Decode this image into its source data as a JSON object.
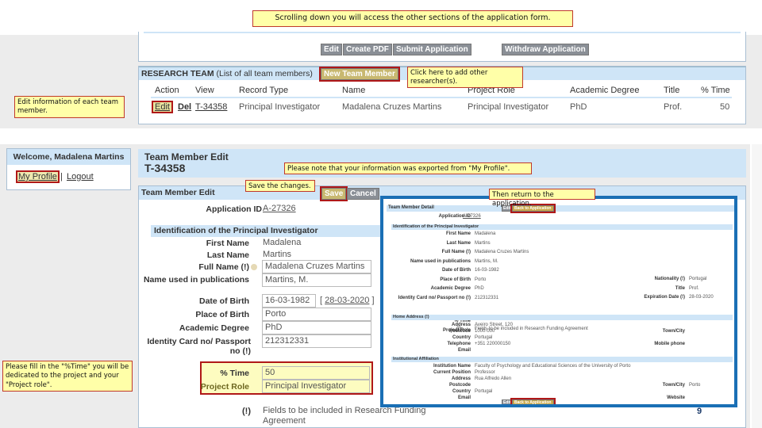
{
  "notes": {
    "top": "Scrolling down you will access the other sections of the application form.",
    "add": "Click here to add other researcher(s).",
    "edit": "Edit information of each team member.",
    "exported": "Please note that your information was exported from \"My Profile\".",
    "save": "Save the changes.",
    "return": "Then return to the application.",
    "fill": "Please fill in the \"%Time\" you will be dedicated to the project and your \"Project role\"."
  },
  "app_buttons": [
    "Edit",
    "Create PDF",
    "Submit Application",
    "Withdraw Application"
  ],
  "team": {
    "title": "RESEARCH TEAM",
    "subtitle": "(List of all team members)",
    "new_button": "New Team Member",
    "columns": [
      "Action",
      "View",
      "Record Type",
      "Name",
      "Project Role",
      "Academic Degree",
      "Title",
      "% Time"
    ],
    "row": {
      "edit": "Edit",
      "del": "Del",
      "view": "T-34358",
      "record_type": "Principal Investigator",
      "name": "Madalena Cruzes Martins",
      "project_role": "Principal Investigator",
      "degree": "PhD",
      "title": "Prof.",
      "time": "50"
    }
  },
  "welcome": {
    "text": "Welcome, Madalena Martins",
    "profile": "My Profile",
    "sep": "|",
    "logout": "Logout"
  },
  "edit": {
    "header": "Team Member Edit",
    "id": "T-34358",
    "bar": "Team Member Edit",
    "save": "Save",
    "cancel": "Cancel",
    "app_id_label": "Application ID",
    "app_id": "A-27326",
    "section": "Identification of the Principal Investigator",
    "first_name_label": "First Name",
    "first_name": "Madalena",
    "last_name_label": "Last Name",
    "last_name": "Martins",
    "full_name_label": "Full Name (!)",
    "full_name": "Madalena Cruzes Martins",
    "pub_name_label": "Name used in publications",
    "pub_name": "Martins, M.",
    "dob_label": "Date of Birth",
    "dob": "16-03-1982",
    "dob_link": "28-03-2020",
    "pob_label": "Place of Birth",
    "pob": "Porto",
    "degree_label": "Academic Degree",
    "degree": "PhD",
    "idcard_label": "Identity Card no/ Passport no (!)",
    "idcard": "212312331",
    "time_label": "% Time",
    "time": "50",
    "role_label": "Project Role",
    "role": "Principal Investigator",
    "footnote_mark": "(!)",
    "footnote": "Fields to be included in Research Funding Agreement"
  },
  "detail": {
    "header": "Team Member Detail",
    "edit": "Edit",
    "back": "Back to Application",
    "app_id_label": "Application ID",
    "sec1": "Identification of the Principal Investigator",
    "labels": [
      "First Name",
      "Last Name",
      "Full Name (!)",
      "Name used in publications",
      "Date of Birth",
      "Place of Birth",
      "Academic Degree",
      "Identity Card no/ Passport no (!)",
      "% Time",
      "Project Role"
    ],
    "values": [
      "Madalena",
      "Martins",
      "Madalena Cruzes Martins",
      "Martins, M.",
      "16-03-1982",
      "Porto",
      "PhD",
      "212312331",
      "",
      ""
    ],
    "right_labels": [
      "Nationality (!)",
      "Title",
      "Expiration Date (!)"
    ],
    "right_values": [
      "Portugal",
      "Prof.",
      "28-03-2020"
    ],
    "sec2": "Home Address (!)",
    "addr_labels": [
      "Address",
      "Postcode",
      "Country",
      "Telephone",
      "Email"
    ],
    "addr_values": [
      "Aveiro Street, 120",
      "1000-000",
      "Portugal",
      "+351 220000150",
      ""
    ],
    "addr_right_labels": [
      "Town/City",
      "Mobile phone"
    ],
    "sec3": "Institutional Affiliation",
    "inst_labels": [
      "Institution Name",
      "Current Position",
      "Address",
      "Postcode",
      "Country",
      "Email"
    ],
    "inst_values": [
      "Faculty of Psychology and Educational Sciences of the University of Porto",
      "Professor",
      "Rua Alfredo Allen",
      "",
      "Portugal",
      ""
    ],
    "inst_right_labels": [
      "Town/City",
      "Website"
    ],
    "inst_right_values": [
      "Porto",
      ""
    ]
  },
  "page_number": "9",
  "colors": {
    "accent_bar": "#cfe5f7",
    "note_bg": "#ffffa8",
    "highlight": "#b01818",
    "frame": "#1a6fb5"
  }
}
